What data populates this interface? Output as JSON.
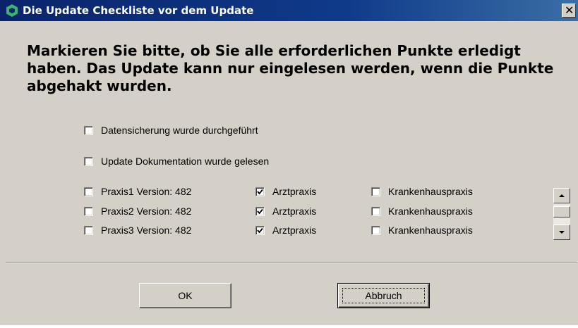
{
  "window": {
    "title": "Die Update Checkliste vor dem Update",
    "close_glyph": "✕",
    "app_icon": "green-hexagon-icon"
  },
  "instructions": "Markieren Sie bitte, ob Sie alle erforderlichen Punkte erledigt haben. Das Update kann nur eingelesen werden, wenn die Punkte abgehakt wurden.",
  "checks": {
    "backup": {
      "label": "Datensicherung wurde durchgeführt",
      "checked": false
    },
    "docs": {
      "label": "Update Dokumentation wurde gelesen",
      "checked": false
    }
  },
  "practices": [
    {
      "name": "Praxis1 Version: 482",
      "name_checked": false,
      "type_a": "Arztpraxis",
      "type_a_checked": true,
      "type_b": "Krankenhauspraxis",
      "type_b_checked": false
    },
    {
      "name": "Praxis2 Version: 482",
      "name_checked": false,
      "type_a": "Arztpraxis",
      "type_a_checked": true,
      "type_b": "Krankenhauspraxis",
      "type_b_checked": false
    },
    {
      "name": "Praxis3 Version: 482",
      "name_checked": false,
      "type_a": "Arztpraxis",
      "type_a_checked": true,
      "type_b": "Krankenhauspraxis",
      "type_b_checked": false
    }
  ],
  "buttons": {
    "ok_label": "OK",
    "cancel_label": "Abbruch"
  },
  "colors": {
    "titlebar": "#0a246a",
    "dialog_bg": "#d4d0c8",
    "icon": "#3cb371"
  }
}
